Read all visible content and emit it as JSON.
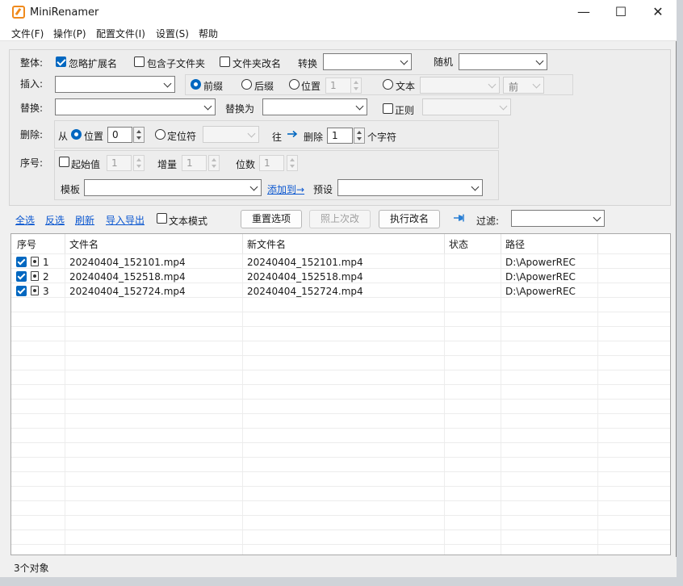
{
  "window": {
    "title": "MiniRenamer"
  },
  "window_controls": {
    "minimize": "—",
    "maximize": "☐",
    "close": "✕"
  },
  "menu": [
    "文件(F)",
    "操作(P)",
    "配置文件(I)",
    "设置(S)",
    "帮助"
  ],
  "whole": {
    "label": "整体:",
    "ignore_ext": {
      "label": "忽略扩展名",
      "checked": true
    },
    "include_subfolders": {
      "label": "包含子文件夹",
      "checked": false
    },
    "rename_folders": {
      "label": "文件夹改名",
      "checked": false
    },
    "convert_label": "转换",
    "convert_value": "",
    "random_label": "随机",
    "random_value": ""
  },
  "insert": {
    "label": "插入:",
    "value": "",
    "prefix": "前缀",
    "suffix": "后缀",
    "position": "位置",
    "position_value": "1",
    "text": "文本",
    "text_value": "",
    "front_value": "前",
    "selected": "prefix"
  },
  "replace": {
    "label": "替换:",
    "value": "",
    "replace_with_label": "替换为",
    "replace_with_value": "",
    "regex": {
      "label": "正则",
      "checked": false
    },
    "regex_option": ""
  },
  "delete": {
    "label": "删除:",
    "from": "从",
    "position": "位置",
    "position_value": "0",
    "locator": "定位符",
    "locator_value": "",
    "direction": "往",
    "delete_label": "删除",
    "count_value": "1",
    "chars_label": "个字符"
  },
  "sequence": {
    "label": "序号:",
    "start": {
      "label": "起始值",
      "checked": false,
      "value": "1"
    },
    "increment_label": "增量",
    "increment_value": "1",
    "digits_label": "位数",
    "digits_value": "1",
    "template_label": "模板",
    "template_value": "",
    "add_to": "添加到→",
    "preset_label": "预设",
    "preset_value": ""
  },
  "toolbar": {
    "select_all": "全选",
    "invert": "反选",
    "refresh": "刷新",
    "import_export": "导入导出",
    "text_mode": "文本模式",
    "reset": "重置选项",
    "as_last": "照上次改",
    "execute": "执行改名",
    "filter_label": "过滤:",
    "filter_value": ""
  },
  "table": {
    "headers": [
      "序号",
      "文件名",
      "新文件名",
      "状态",
      "路径"
    ],
    "rows": [
      {
        "index": "1",
        "filename": "20240404_152101.mp4",
        "newname": "20240404_152101.mp4",
        "status": "",
        "path": "D:\\ApowerREC",
        "checked": true
      },
      {
        "index": "2",
        "filename": "20240404_152518.mp4",
        "newname": "20240404_152518.mp4",
        "status": "",
        "path": "D:\\ApowerREC",
        "checked": true
      },
      {
        "index": "3",
        "filename": "20240404_152724.mp4",
        "newname": "20240404_152724.mp4",
        "status": "",
        "path": "D:\\ApowerREC",
        "checked": true
      }
    ]
  },
  "status": {
    "count": "3个对象"
  },
  "colors": {
    "accent": "#0067c0",
    "link": "#0b57d0",
    "app_icon": "#f08a1c"
  }
}
